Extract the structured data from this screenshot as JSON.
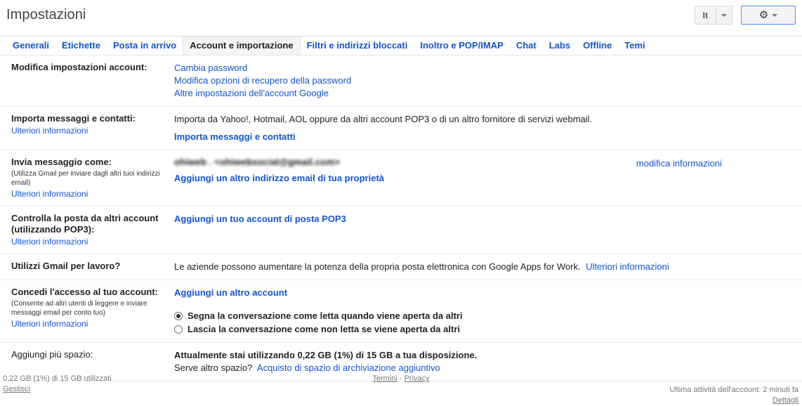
{
  "header": {
    "title": "Impostazioni",
    "language_button": {
      "label": "It",
      "caret_icon": "chevron-down-icon"
    },
    "gear_button": {
      "icon": "gear-icon",
      "caret_icon": "chevron-down-icon"
    }
  },
  "tabs": [
    {
      "label": "Generali",
      "active": false
    },
    {
      "label": "Etichette",
      "active": false
    },
    {
      "label": "Posta in arrivo",
      "active": false
    },
    {
      "label": "Account e importazione",
      "active": true
    },
    {
      "label": "Filtri e indirizzi bloccati",
      "active": false
    },
    {
      "label": "Inoltro e POP/IMAP",
      "active": false
    },
    {
      "label": "Chat",
      "active": false
    },
    {
      "label": "Labs",
      "active": false
    },
    {
      "label": "Offline",
      "active": false
    },
    {
      "label": "Temi",
      "active": false
    }
  ],
  "sections": {
    "change_account": {
      "label": "Modifica impostazioni account:",
      "links": [
        "Cambia password",
        "Modifica opzioni di recupero della password",
        "Altre impostazioni dell'account Google"
      ]
    },
    "import": {
      "label": "Importa messaggi e contatti:",
      "more": "Ulteriori informazioni",
      "description": "Importa da Yahoo!, Hotmail, AOL oppure da altri account POP3 o di un altro fornitore di servizi webmail.",
      "action": "Importa messaggi e contatti"
    },
    "send_as": {
      "label": "Invia messaggio come:",
      "note": "(Utilizza Gmail per inviare dagli altri tuoi indirizzi email)",
      "more": "Ulteriori informazioni",
      "address": "ohiweb . <ohiwebsocial@gmail.com>",
      "edit_link": "modifica informazioni",
      "action": "Aggiungi un altro indirizzo email di tua proprietà"
    },
    "pop3": {
      "label": "Controlla la posta da altri account (utilizzando POP3):",
      "more": "Ulteriori informazioni",
      "action": "Aggiungi un tuo account di posta POP3"
    },
    "work": {
      "label": "Utilizzi Gmail per lavoro?",
      "description": "Le aziende possono aumentare la potenza della propria posta elettronica con Google Apps for Work.",
      "more": "Ulteriori informazioni"
    },
    "grant_access": {
      "label": "Concedi l'accesso al tuo account:",
      "note": "(Consente ad altri utenti di leggere e inviare messaggi email per conto tuo)",
      "more": "Ulteriori informazioni",
      "action": "Aggiungi un altro account",
      "options": [
        {
          "label": "Segna la conversazione come letta quando viene aperta da altri",
          "selected": true
        },
        {
          "label": "Lascia la conversazione come non letta se viene aperta da altri",
          "selected": false
        }
      ]
    },
    "storage": {
      "label": "Aggiungi più spazio:",
      "usage": "Attualmente stai utilizzando 0,22 GB (1%) di 15 GB a tua disposizione.",
      "question": "Serve altro spazio?",
      "buy_link": "Acquisto di spazio di archiviazione aggiuntivo"
    }
  },
  "footer": {
    "storage_text": "0,22 GB (1%) di 15 GB utilizzati",
    "manage_link": "Gestisci",
    "terms_link": "Termini",
    "separator": "-",
    "privacy_link": "Privacy",
    "last_activity": "Ultima attività dell'account: 2 minuti fa",
    "details_link": "Dettagli"
  }
}
